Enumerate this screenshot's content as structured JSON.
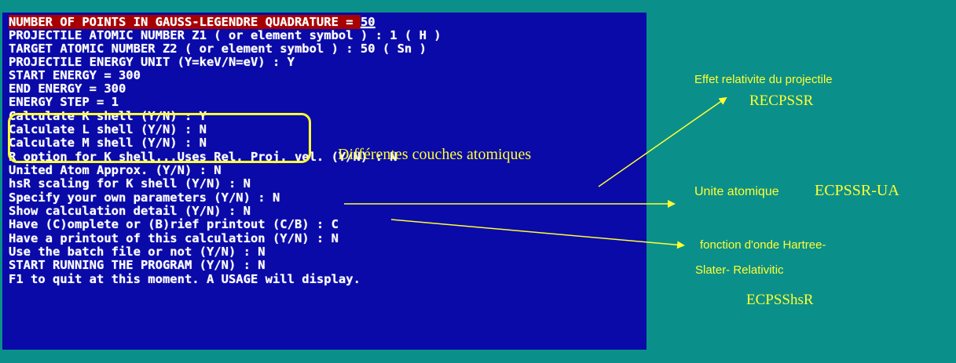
{
  "console": {
    "lines": [
      {
        "text": "NUMBER OF POINTS IN GAUSS-LEGENDRE QUADRATURE = ",
        "cursor_value": "50"
      },
      {
        "text": "PROJECTILE ATOMIC NUMBER Z1 ( or element symbol ) : 1 ( H )"
      },
      {
        "text": "TARGET ATOMIC NUMBER Z2 ( or element symbol ) : 50 ( Sn )"
      },
      {
        "text": "PROJECTILE ENERGY UNIT (Y=keV/N=eV) : Y"
      },
      {
        "text": "START ENERGY = 300"
      },
      {
        "text": "END ENERGY = 300"
      },
      {
        "text": "ENERGY STEP = 1"
      },
      {
        "text": "Calculate K shell (Y/N) : Y"
      },
      {
        "text": "Calculate L shell (Y/N) : N"
      },
      {
        "text": "Calculate M shell (Y/N) : N"
      },
      {
        "text": "R option for K shell...Uses Rel. Proj. vel. (Y/N) : N"
      },
      {
        "text": "United Atom Approx. (Y/N) : N"
      },
      {
        "text": "hsR scaling for K shell (Y/N) : N"
      },
      {
        "text": "Specify your own parameters (Y/N) : N"
      },
      {
        "text": "Show calculation detail (Y/N) : N"
      },
      {
        "text": "Have (C)omplete or (B)rief printout (C/B) : C"
      },
      {
        "text": "Have a printout of this calculation (Y/N) : N"
      },
      {
        "text": "Use the batch file or not (Y/N) : N"
      },
      {
        "text": "START RUNNING THE PROGRAM (Y/N) : N"
      },
      {
        "text": "F1 to quit at this moment. A USAGE will display."
      }
    ]
  },
  "annotations": {
    "shells": "Différentes couches atomiques",
    "relativistic_title": "Effet relativite du projectile",
    "relativistic_code": "RECPSSR",
    "united_atom_label": "Unite atomique",
    "united_atom_code": "ECPSSR-UA",
    "hs_line1": "fonction d'onde Hartree-",
    "hs_line2": "Slater- Relativitic",
    "hs_code": "ECPSShsR"
  },
  "colors": {
    "frame_bg": "#0b8f8a",
    "console_bg": "#0a0aa8",
    "console_text": "#ffffff",
    "highlight_bg": "#a80000",
    "annotation": "#ffff33"
  }
}
